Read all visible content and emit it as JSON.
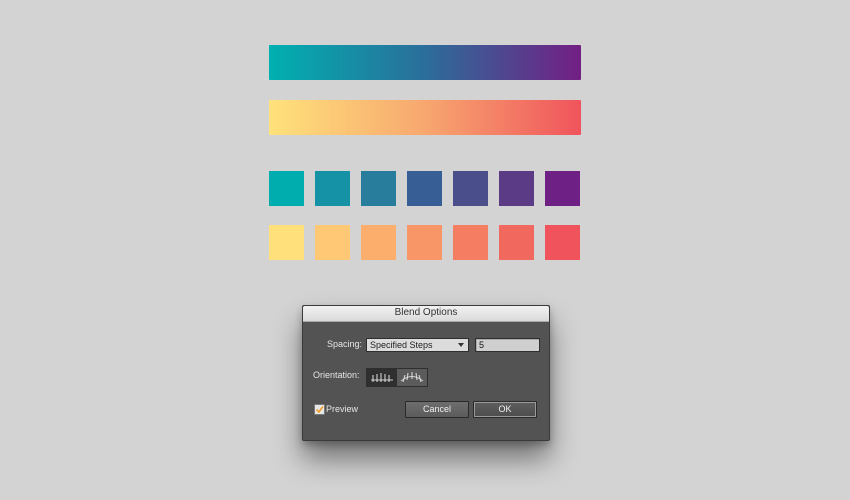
{
  "gradients": {
    "cool": {
      "from": "#00b0b0",
      "mid": "#2b6e9b",
      "to": "#731f84"
    },
    "warm": {
      "from": "#ffe27b",
      "mid": "#f7a76f",
      "to": "#f0545c"
    }
  },
  "swatches": {
    "cool": [
      "#00adae",
      "#1592a5",
      "#277d9b",
      "#375f95",
      "#4a4e8a",
      "#5b3b86",
      "#6f2084"
    ],
    "warm": [
      "#ffe07a",
      "#fec874",
      "#fcaf6d",
      "#f99667",
      "#f57e62",
      "#f1685f",
      "#f0535b"
    ]
  },
  "dialog": {
    "title": "Blend Options",
    "spacing_label": "Spacing:",
    "spacing_value": "Specified Steps",
    "steps_value": "5",
    "orientation_label": "Orientation:",
    "orientation_options": [
      "align-to-page-icon",
      "align-to-path-icon"
    ],
    "preview_label": "Preview",
    "preview_checked": true,
    "cancel_label": "Cancel",
    "ok_label": "OK"
  }
}
